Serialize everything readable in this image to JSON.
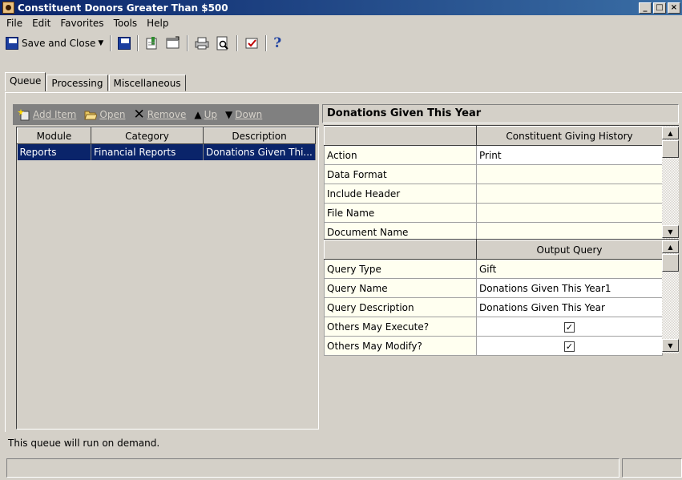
{
  "window": {
    "title": "Constituent Donors Greater Than $500",
    "min": "_",
    "max": "□",
    "close": "×"
  },
  "menu": [
    "File",
    "Edit",
    "Favorites",
    "Tools",
    "Help"
  ],
  "toolbar": {
    "save_close": "Save and Close",
    "help": "?"
  },
  "tabs": [
    "Queue",
    "Processing",
    "Miscellaneous"
  ],
  "queue_toolbar": {
    "add": "Add Item",
    "open": "Open",
    "remove": "Remove",
    "up": "Up",
    "down": "Down"
  },
  "queue_grid": {
    "headers": [
      "Module",
      "Category",
      "Description"
    ],
    "rows": [
      [
        "Reports",
        "Financial Reports",
        "Donations Given Thi..."
      ]
    ]
  },
  "details": {
    "title": "Donations Given This Year",
    "section1_header": "Constituent Giving History",
    "section1": [
      {
        "label": "Action",
        "value": "Print"
      },
      {
        "label": "Data Format",
        "value": ""
      },
      {
        "label": "Include Header",
        "value": ""
      },
      {
        "label": "File Name",
        "value": ""
      },
      {
        "label": "Document Name",
        "value": ""
      }
    ],
    "section2_header": "Output Query",
    "section2": [
      {
        "label": "Query Type",
        "value": "Gift"
      },
      {
        "label": "Query Name",
        "value": "Donations Given This Year1"
      },
      {
        "label": "Query Description",
        "value": "Donations Given This Year"
      },
      {
        "label": "Others May Execute?",
        "value": "✓"
      },
      {
        "label": "Others May Modify?",
        "value": "✓"
      }
    ]
  },
  "status": {
    "message": "This queue will run on demand."
  },
  "colors": {
    "title_start": "#0a246a",
    "title_end": "#3a6ea5",
    "selection": "#0a246a",
    "face": "#d4d0c8"
  }
}
